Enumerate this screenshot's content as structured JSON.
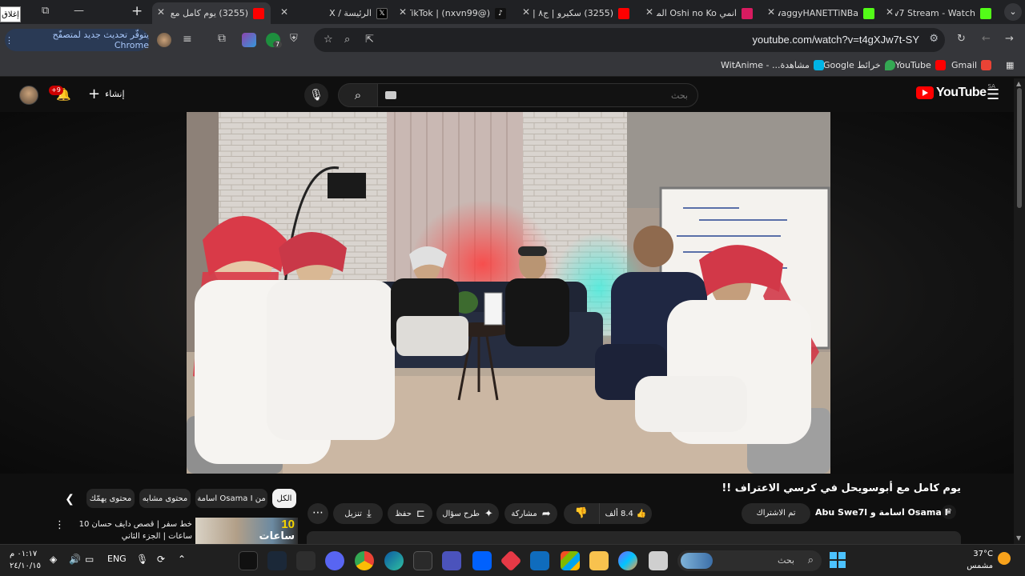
{
  "browser": {
    "tabs": [
      {
        "title": "Nxv7 Stream - Watch",
        "favicon_color": "#53fc18"
      },
      {
        "title": "SwaggyHANETTiNBa",
        "favicon_color": "#53fc18"
      },
      {
        "title": "انمي Oshi no Ko المو",
        "favicon_color": "#d81b60"
      },
      {
        "title": "(3255) سكيرو | ج٨ | ش",
        "favicon_color": "#ff0000"
      },
      {
        "title": "(@nxvn99) | TikTok",
        "favicon_color": "#000000"
      },
      {
        "title": "الرئيسة / X",
        "favicon_color": "#000000"
      },
      {
        "title": "(3255) يوم كامل مع أ",
        "favicon_color": "#ff0000"
      }
    ],
    "close_box_label": "إغلاق",
    "url": "youtube.com/watch?v=t4gXJw7t-SY",
    "update_button": "يتوفّر تحديث جديد لمتصفّح Chrome",
    "extension_badge": "7",
    "bookmarks": [
      {
        "label": "Gmail",
        "color": "#ea4335"
      },
      {
        "label": "YouTube",
        "color": "#ff0000"
      },
      {
        "label": "خرائط Google",
        "color": "#34a853"
      },
      {
        "label": "مشاهدة... - WitAnime",
        "color": "#00b4e6"
      }
    ]
  },
  "youtube": {
    "logo_text": "YouTube",
    "country_code": "SA",
    "search_placeholder": "بحث",
    "create_label": "إنشاء",
    "notification_count": "+9",
    "video_title": "يوم كامل مع أبوسويحل في كرسي الاعتراف !!",
    "channel_name": "Osama I اسامة و Abu Swe7l",
    "subscribed_label": "تم الاشتراك",
    "likes": "8.4 ألف",
    "actions": {
      "share": "مشاركة",
      "ask": "طرح سؤال",
      "save": "حفظ",
      "download": "تنزيل"
    },
    "chips": [
      "الكل",
      "من Osama I اسامة",
      "محتوى مشابه",
      "محتوى يهمّك"
    ],
    "recommended": {
      "title": "خط سفر | قصص دايف حسان 10 ساعات | الجزء الثاني",
      "thumb_number": "10",
      "thumb_word": "ساعات"
    }
  },
  "taskbar": {
    "search_placeholder": "بحث",
    "language": "ENG",
    "time": "٠١:١٧ م",
    "date": "٢٤/١٠/١٥",
    "temperature": "37°C",
    "weather": "مشمس"
  }
}
